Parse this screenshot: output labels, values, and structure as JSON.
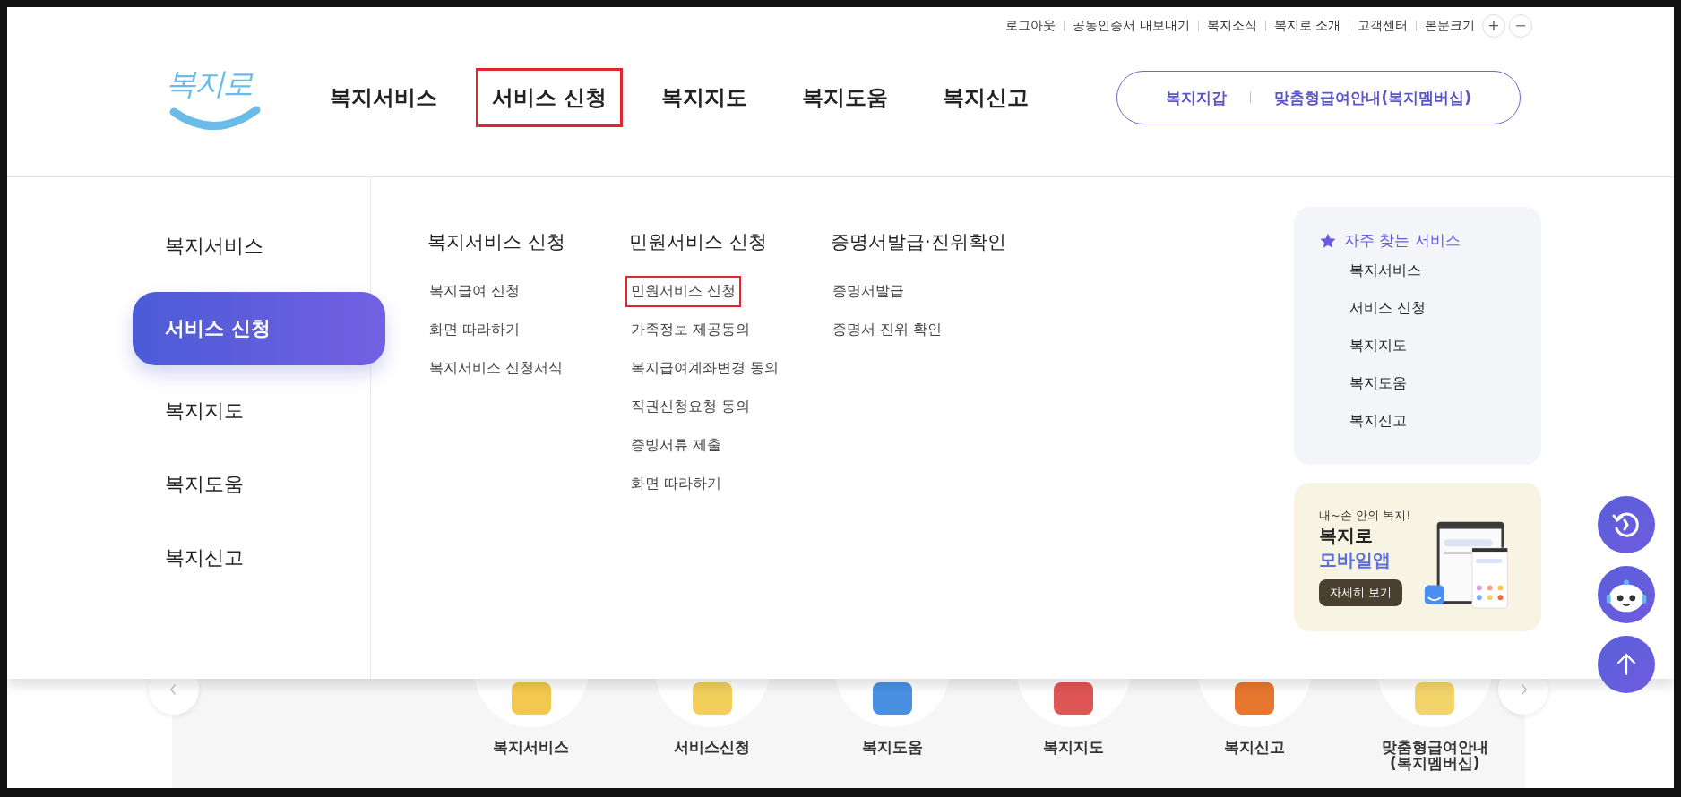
{
  "utility_links": [
    {
      "label": "로그아웃"
    },
    {
      "label": "공동인증서 내보내기"
    },
    {
      "label": "복지소식"
    },
    {
      "label": "복지로 소개"
    },
    {
      "label": "고객센터"
    }
  ],
  "font_size": {
    "label": "본문크기",
    "buttons": [
      {
        "kind": "plus",
        "label": "+"
      },
      {
        "kind": "minus",
        "label": "−"
      }
    ]
  },
  "logo": {
    "text": "복지로"
  },
  "nav": [
    {
      "label": "복지서비스",
      "highlighted": false
    },
    {
      "label": "서비스 신청",
      "highlighted": true
    },
    {
      "label": "복지지도",
      "highlighted": false
    },
    {
      "label": "복지도움",
      "highlighted": false
    },
    {
      "label": "복지신고",
      "highlighted": false
    }
  ],
  "header_buttons": [
    "복지지갑",
    "맞춤형급여안내(복지멤버십)"
  ],
  "menu": {
    "categories": [
      {
        "label": "복지서비스",
        "selected": false
      },
      {
        "label": "서비스 신청",
        "selected": true
      },
      {
        "label": "복지지도",
        "selected": false
      },
      {
        "label": "복지도움",
        "selected": false
      },
      {
        "label": "복지신고",
        "selected": false
      }
    ],
    "columns": [
      {
        "title": "복지서비스 신청",
        "items": [
          {
            "label": "복지급여 신청",
            "highlighted": false
          },
          {
            "label": "화면 따라하기",
            "highlighted": false
          },
          {
            "label": "복지서비스 신청서식",
            "highlighted": false
          }
        ]
      },
      {
        "title": "민원서비스 신청",
        "items": [
          {
            "label": "민원서비스 신청",
            "highlighted": true
          },
          {
            "label": "가족정보 제공동의",
            "highlighted": false
          },
          {
            "label": "복지급여계좌변경 동의",
            "highlighted": false
          },
          {
            "label": "직권신청요청 동의",
            "highlighted": false
          },
          {
            "label": "증빙서류 제출",
            "highlighted": false
          },
          {
            "label": "화면 따라하기",
            "highlighted": false
          }
        ]
      },
      {
        "title": "증명서발급·진위확인",
        "items": [
          {
            "label": "증명서발급",
            "highlighted": false
          },
          {
            "label": "증명서 진위 확인",
            "highlighted": false
          }
        ]
      }
    ]
  },
  "favorites": {
    "title": "자주 찾는 서비스",
    "items": [
      "복지서비스",
      "서비스 신청",
      "복지지도",
      "복지도움",
      "복지신고"
    ]
  },
  "app_banner": {
    "tagline": "내~손 안의 복지!",
    "title": "복지로",
    "subtitle": "모바일앱",
    "button": "자세히 보기"
  },
  "floating_buttons": [
    {
      "kind": "history"
    },
    {
      "kind": "chatbot"
    },
    {
      "kind": "top"
    }
  ],
  "carousel": {
    "items": [
      {
        "label": "복지서비스",
        "color": "#f2c94c"
      },
      {
        "label": "서비스신청",
        "color": "#f2cf5b"
      },
      {
        "label": "복지도움",
        "color": "#4a90e2"
      },
      {
        "label": "복지지도",
        "color": "#e05555"
      },
      {
        "label": "복지신고",
        "color": "#e8772e"
      },
      {
        "label": "맞춤형급여안내\n(복지멤버십)",
        "color": "#f2d46b"
      }
    ]
  }
}
